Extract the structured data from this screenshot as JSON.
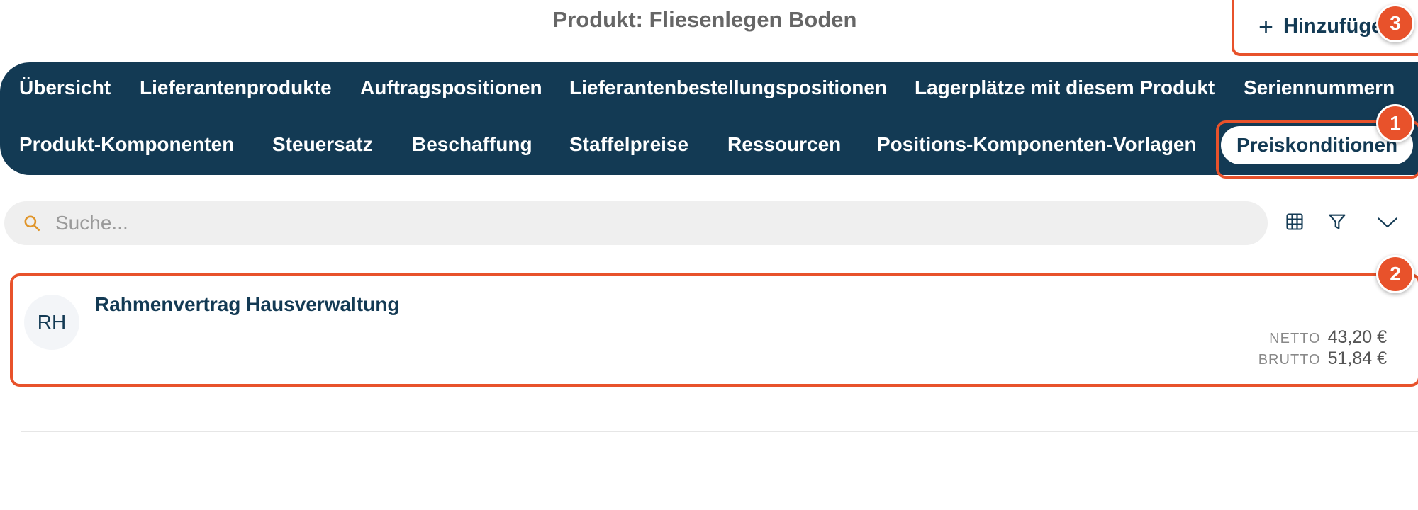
{
  "header": {
    "title": "Produkt: Fliesenlegen Boden"
  },
  "toolbar": {
    "add_label": "Hinzufüge",
    "add_icon": "plus-icon"
  },
  "tabs": {
    "row1": [
      {
        "label": "Übersicht"
      },
      {
        "label": "Lieferantenprodukte"
      },
      {
        "label": "Auftragspositionen"
      },
      {
        "label": "Lieferantenbestellungspositionen"
      },
      {
        "label": "Lagerplätze mit diesem Produkt"
      },
      {
        "label": "Seriennummern"
      }
    ],
    "row2": [
      {
        "label": "Produkt-Komponenten"
      },
      {
        "label": "Steuersatz"
      },
      {
        "label": "Beschaffung"
      },
      {
        "label": "Staffelpreise"
      },
      {
        "label": "Ressourcen"
      },
      {
        "label": "Positions-Komponenten-Vorlagen"
      },
      {
        "label": "Preiskonditionen",
        "active": true
      }
    ]
  },
  "search": {
    "placeholder": "Suche...",
    "value": ""
  },
  "tools": {
    "icons": [
      "table-icon",
      "filter-icon",
      "chevron-down-icon"
    ]
  },
  "list": {
    "items": [
      {
        "initials": "RH",
        "title": "Rahmenvertrag Hausverwaltung",
        "netto_label": "NETTO",
        "netto_value": "43,20 €",
        "brutto_label": "BRUTTO",
        "brutto_value": "51,84 €"
      }
    ]
  },
  "annotations": {
    "badge1": "1",
    "badge2": "2",
    "badge3": "3"
  },
  "colors": {
    "primary": "#133a54",
    "accent": "#e8522b",
    "search_bg": "#efefef",
    "search_icon": "#e0952a"
  }
}
